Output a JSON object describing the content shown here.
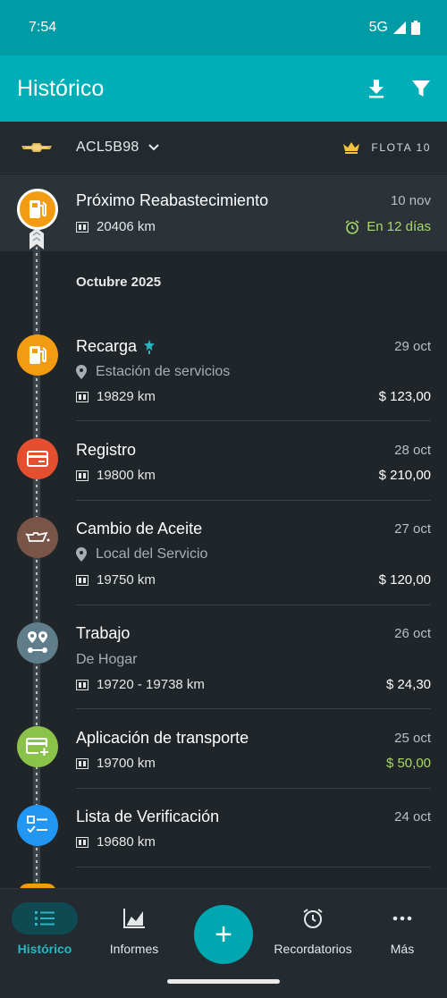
{
  "status_bar": {
    "time": "7:54",
    "network": "5G"
  },
  "app_bar": {
    "title": "Histórico",
    "download_icon": "download-icon",
    "filter_icon": "filter-icon"
  },
  "vehicle": {
    "plate": "ACL5B98",
    "logo": "chevrolet-logo",
    "fleet_label": "FLOTA 10"
  },
  "next_refuel": {
    "title": "Próximo Reabastecimiento",
    "date": "10 nov",
    "odometer": "20406 km",
    "reminder": "En 12 días"
  },
  "month": "Octubre 2025",
  "entries": [
    {
      "title": "Recarga",
      "date": "29 oct",
      "subtitle": "Estación de servicios",
      "odometer": "19829 km",
      "amount": "$ 123,00"
    },
    {
      "title": "Registro",
      "date": "28 oct",
      "odometer": "19800 km",
      "amount": "$ 210,00"
    },
    {
      "title": "Cambio de Aceite",
      "date": "27 oct",
      "subtitle": "Local del Servicio",
      "odometer": "19750 km",
      "amount": "$ 120,00"
    },
    {
      "title": "Trabajo",
      "date": "26 oct",
      "subtitle": "De Hogar",
      "odometer": "19720 - 19738 km",
      "amount": "$ 24,30"
    },
    {
      "title": "Aplicación de transporte",
      "date": "25 oct",
      "odometer": "19700 km",
      "amount": "$ 50,00"
    },
    {
      "title": "Lista de Verificación",
      "date": "24 oct",
      "odometer": "19680 km"
    }
  ],
  "colors": {
    "fuel": "#f39c12",
    "expense": "#e4502f",
    "service": "#795548",
    "route": "#607d8b",
    "income": "#8bc34a",
    "checklist": "#2196f3",
    "accent": "#00aeb7"
  },
  "bottom_nav": {
    "history": "Histórico",
    "reports": "Informes",
    "add": "+",
    "reminders": "Recordatorios",
    "more": "Más"
  }
}
